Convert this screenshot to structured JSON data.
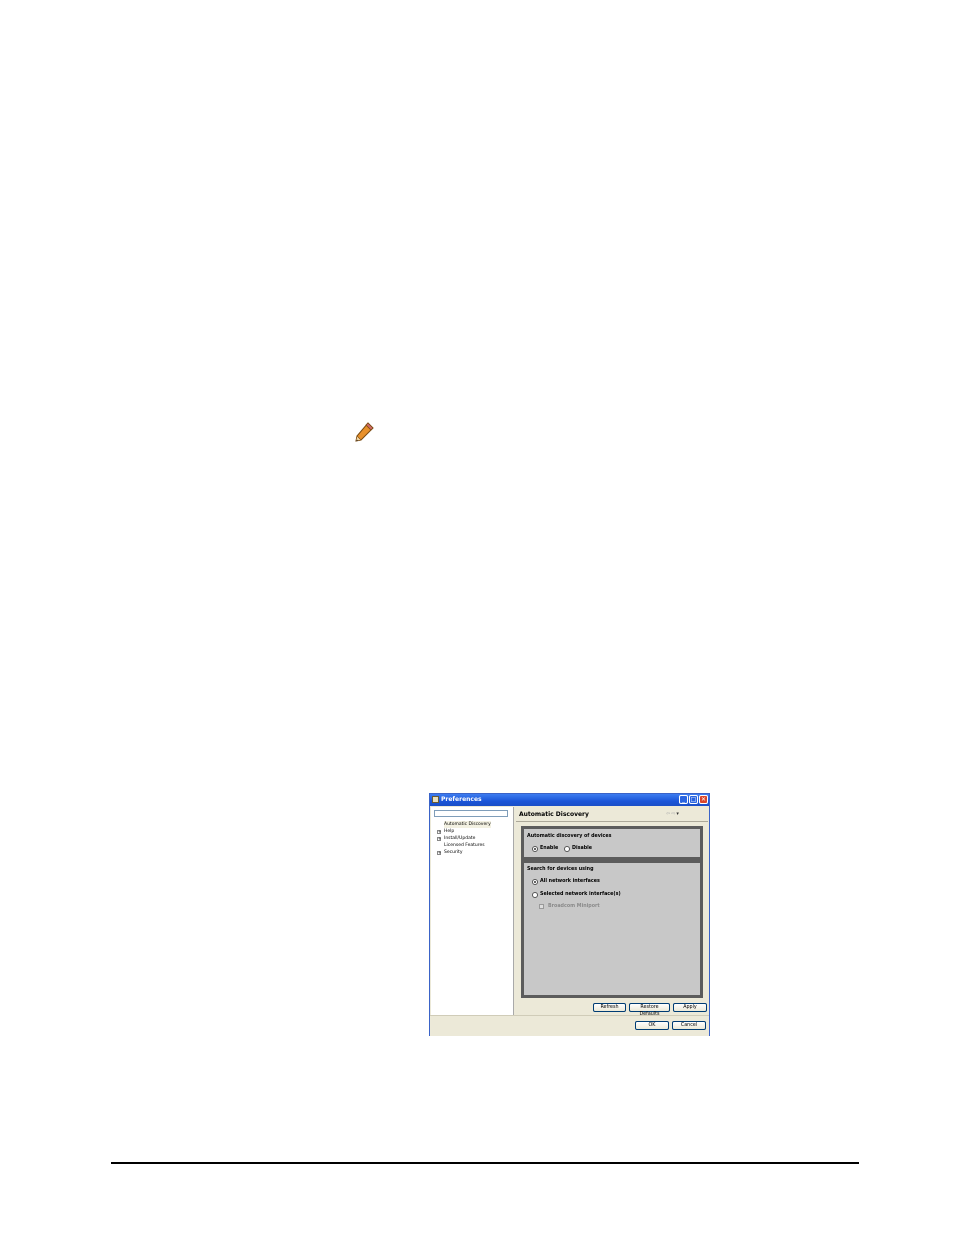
{
  "icons": {
    "note": "pencil-icon"
  },
  "window": {
    "title": "Preferences",
    "controls": [
      "minimize",
      "maximize",
      "close"
    ]
  },
  "filter": {
    "value": ""
  },
  "tree": [
    {
      "label": "Automatic Discovery",
      "expandable": false,
      "selected": true
    },
    {
      "label": "Help",
      "expandable": true,
      "selected": false
    },
    {
      "label": "Install/Update",
      "expandable": true,
      "selected": false
    },
    {
      "label": "Licensed Features",
      "expandable": false,
      "selected": false
    },
    {
      "label": "Security",
      "expandable": true,
      "selected": false
    }
  ],
  "page": {
    "title": "Automatic Discovery"
  },
  "discovery_group": {
    "title": "Automatic discovery of devices",
    "enable_label": "Enable",
    "disable_label": "Disable",
    "selected": "Enable"
  },
  "search_group": {
    "title": "Search for devices using",
    "all_label": "All network interfaces",
    "selected_label": "Selected network interface(s)",
    "broadcom_label": "Broadcom Miniport",
    "selected": "All network interfaces"
  },
  "buttons": {
    "refresh": "Refresh",
    "restore_defaults": "Restore Defaults",
    "apply": "Apply",
    "ok": "OK",
    "cancel": "Cancel"
  }
}
